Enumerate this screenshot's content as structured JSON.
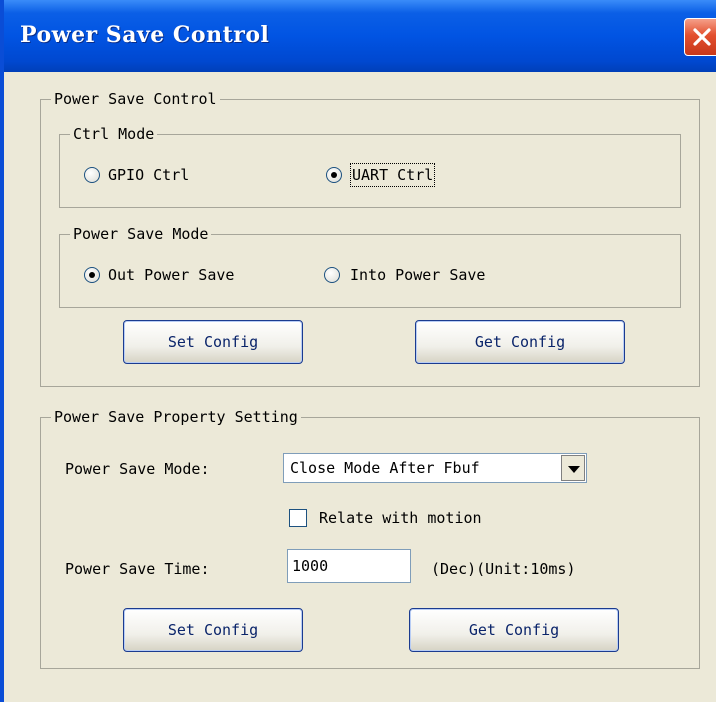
{
  "window": {
    "title": "Power Save Control"
  },
  "control_group": {
    "title": "Power Save Control",
    "ctrl_mode": {
      "title": "Ctrl Mode",
      "options": [
        {
          "label": "GPIO Ctrl",
          "checked": false
        },
        {
          "label": "UART Ctrl",
          "checked": true
        }
      ]
    },
    "mode": {
      "title": "Power Save Mode",
      "options": [
        {
          "label": "Out Power Save",
          "checked": true
        },
        {
          "label": "Into Power Save",
          "checked": false
        }
      ]
    },
    "set_button": "Set Config",
    "get_button": "Get Config"
  },
  "property_group": {
    "title": "Power Save Property Setting",
    "mode_label": "Power Save Mode:",
    "mode_value": "Close Mode After Fbuf",
    "relate_label": "Relate with motion",
    "relate_checked": false,
    "time_label": "Power Save Time:",
    "time_value": "1000",
    "time_unit": "(Dec)(Unit:10ms)",
    "set_button": "Set Config",
    "get_button": "Get Config"
  },
  "icons": {
    "close": "close-icon",
    "dropdown": "chevron-down-icon"
  },
  "colors": {
    "titlebar": "#0154e3",
    "dialog_bg": "#ece9d8",
    "close_button": "#e3502f"
  }
}
